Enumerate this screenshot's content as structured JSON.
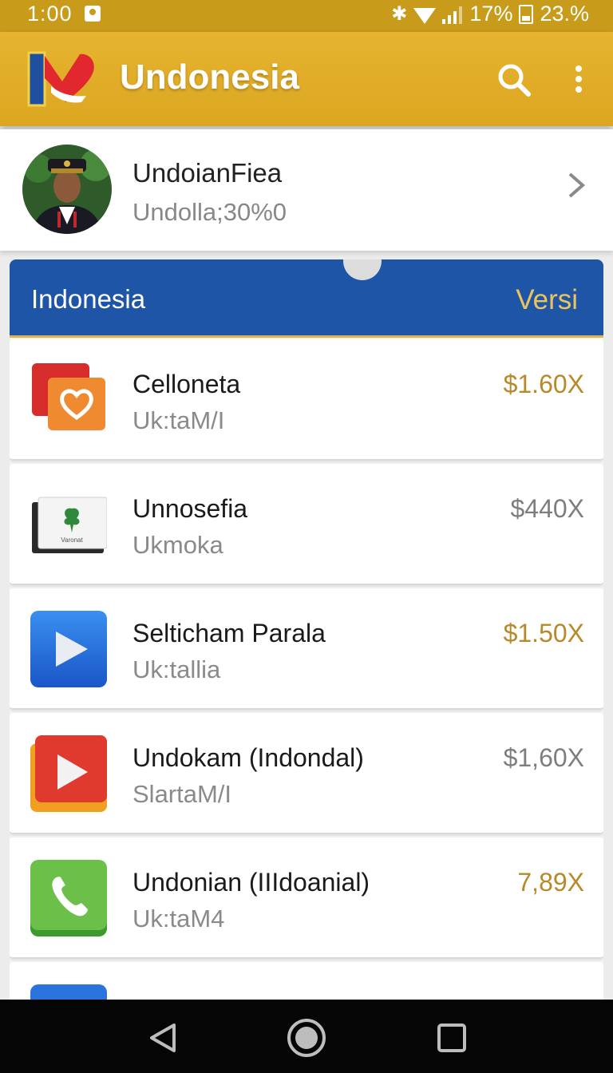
{
  "status_bar": {
    "time": "1:00",
    "battery_percent": "17%",
    "extra_percent": "23.%"
  },
  "app_bar": {
    "title": "Undonesia",
    "logo_icon": "flag-heart-logo-icon",
    "search_icon": "search-icon",
    "more_icon": "more-vert-icon",
    "accent_color": "#dca620"
  },
  "profile": {
    "name": "UndoianFiea",
    "subtitle": "Undolla;30%0",
    "chevron_icon": "chevron-right-icon"
  },
  "panel": {
    "header_left": "Indonesia",
    "header_right": "Versi",
    "header_color": "#1e55a6"
  },
  "items": [
    {
      "title": "Celloneta",
      "subtitle": "Uk:taM/I",
      "price": "$1.60X",
      "price_color": "#b7892a",
      "icon": "heart-app-icon"
    },
    {
      "title": "Unnosefia",
      "subtitle": "Ukmoka",
      "price": "$440X",
      "price_color": "#7e7e7e",
      "icon": "leaf-box-app-icon",
      "icon_text": "Varonat"
    },
    {
      "title": "Selticham Parala",
      "subtitle": "Uk:tallia",
      "price": "$1.50X",
      "price_color": "#b7892a",
      "icon": "blue-play-app-icon"
    },
    {
      "title": "Undokam (Indondal)",
      "subtitle": "SlartaM/I",
      "price": "$1,60X",
      "price_color": "#7e7e7e",
      "icon": "red-play-app-icon"
    },
    {
      "title": "Undonian (IIIdoanial)",
      "subtitle": "Uk:taM4",
      "price": "7,89X",
      "price_color": "#b7892a",
      "icon": "phone-app-icon"
    },
    {
      "title": "",
      "subtitle": "",
      "price": "",
      "price_color": "#b7892a",
      "icon": "blue-app-icon"
    }
  ],
  "nav_bar": {
    "back_icon": "back-triangle-icon",
    "home_icon": "home-circle-icon",
    "recents_icon": "recents-square-icon"
  }
}
